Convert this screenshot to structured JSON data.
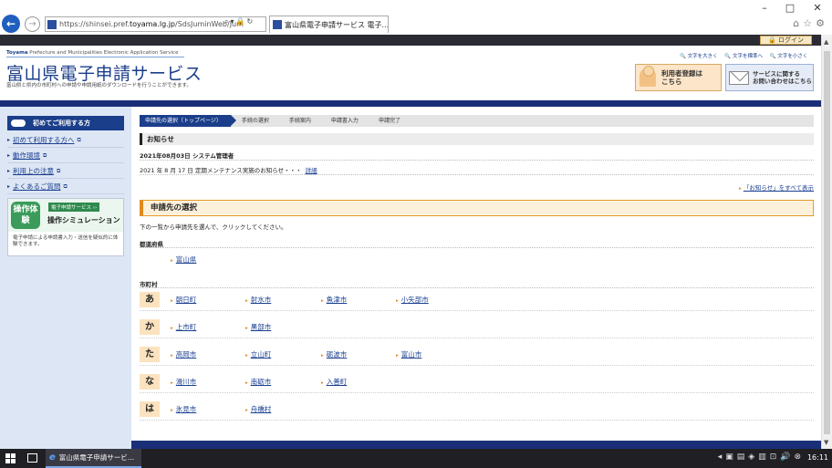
{
  "browser": {
    "url_prefix": "https://shinsei.pref.",
    "url_host": "toyama.lg.jp",
    "url_path": "/SdsJuminWeb/Jum",
    "tab_title": "富山県電子申請サービス 電子...",
    "window_controls": [
      "–",
      "□",
      "✕"
    ],
    "toolbar_icons": [
      "⌂",
      "☆",
      "⚙"
    ]
  },
  "header": {
    "login_label": "🔒 ログイン",
    "brand_bold": "Toyama",
    "brand_rest": " Prefecture and Municipalities Electronic Application Service",
    "title": "富山県電子申請サービス",
    "subtitle": "富山県と県内の市町村への申請や申請用紙のダウンロードを行うことができます。",
    "font_larger": "🔍 文字を大きく",
    "font_standard": "🔍 文字を標準へ",
    "font_smaller": "🔍 文字を小さく",
    "register_label_1": "利用者登録は",
    "register_label_2": "こちら",
    "contact_label_1": "サービスに関する",
    "contact_label_2": "お問い合わせはこちら"
  },
  "sidebar": {
    "heading": "初めてご利用する方",
    "items": [
      {
        "label": "初めて利用する方へ"
      },
      {
        "label": "動作環境"
      },
      {
        "label": "利用上の注意"
      },
      {
        "label": "よくあるご質問"
      }
    ],
    "sim_badge": "操作体験",
    "sim_small": "電子申請サービス ››",
    "sim_title": "操作シミュレーション",
    "sim_desc": "電子申請による申請書入力・送信を疑似的に体験できます。"
  },
  "breadcrumb": [
    "申請先の選択（トップページ）",
    "手続の選択",
    "手続案内",
    "申請書入力",
    "申請完了"
  ],
  "notice": {
    "heading": "お知らせ",
    "date_line": "2021年08月03日 システム管理者",
    "body": "2021 年 8 月 17 日 定期メンテナンス実施のお知らせ・・・",
    "detail_link": "詳細",
    "all_link": "「お知らせ」をすべて表示"
  },
  "selection": {
    "heading": "申請先の選択",
    "description": "下の一覧から申請先を選んで、クリックしてください。",
    "pref_label": "都道府県",
    "pref_link": "富山県",
    "muni_label": "市町村",
    "rows": [
      {
        "kana": "あ",
        "cities": [
          "朝日町",
          "射水市",
          "魚津市",
          "小矢部市"
        ]
      },
      {
        "kana": "か",
        "cities": [
          "上市町",
          "黒部市"
        ]
      },
      {
        "kana": "た",
        "cities": [
          "高岡市",
          "立山町",
          "砺波市",
          "富山市"
        ]
      },
      {
        "kana": "な",
        "cities": [
          "滑川市",
          "南砺市",
          "入善町"
        ]
      },
      {
        "kana": "は",
        "cities": [
          "氷見市",
          "舟橋村"
        ]
      }
    ]
  },
  "taskbar": {
    "ie_label": "富山県電子申請サービ...",
    "clock": "16:11"
  }
}
